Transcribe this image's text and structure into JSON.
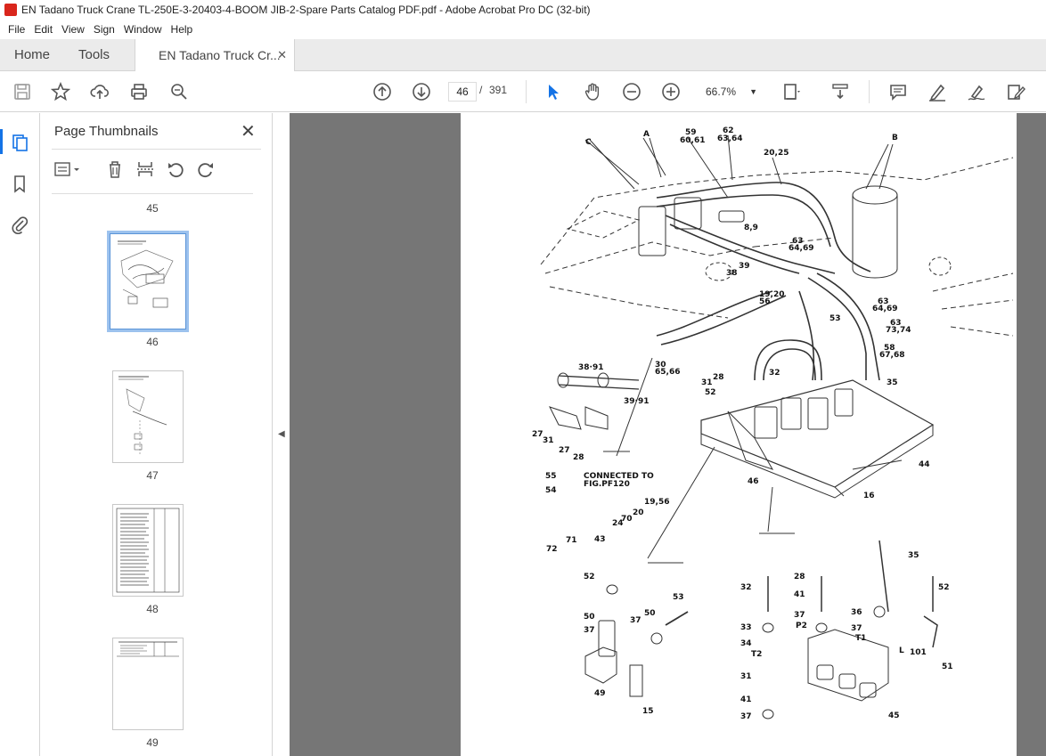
{
  "window": {
    "title": "EN Tadano Truck Crane TL-250E-3-20403-4-BOOM JIB-2-Spare Parts Catalog PDF.pdf - Adobe Acrobat Pro DC (32-bit)"
  },
  "menu": [
    "File",
    "Edit",
    "View",
    "Sign",
    "Window",
    "Help"
  ],
  "tabs": {
    "home": "Home",
    "tools": "Tools",
    "doc": "EN Tadano Truck Cr...",
    "close": "✕"
  },
  "toolbar": {
    "page_current": "46",
    "page_sep": "/",
    "page_total": "391",
    "zoom": "66.7%"
  },
  "panel": {
    "title": "Page Thumbnails",
    "close": "✕",
    "thumbnails": [
      "45",
      "46",
      "47",
      "48",
      "49"
    ],
    "selected": "46"
  },
  "diagram": {
    "labels": [
      "C",
      "A",
      "B",
      "59",
      "60,61",
      "62",
      "63,64",
      "20,25",
      "8,9",
      "63",
      "64,69",
      "39",
      "38",
      "19,20",
      "56",
      "53",
      "63",
      "64,69",
      "63",
      "73,74",
      "58",
      "67,68",
      "38·91",
      "30",
      "65,66",
      "31",
      "28",
      "32",
      "52",
      "35",
      "39·91",
      "27",
      "31",
      "27",
      "28",
      "44",
      "46",
      "16",
      "55",
      "54",
      "CONNECTED TO",
      "FIG.PF120",
      "19,56",
      "20",
      "70",
      "24",
      "43",
      "71",
      "72",
      "35",
      "52",
      "53",
      "32",
      "28",
      "41",
      "52",
      "50",
      "37",
      "37",
      "50",
      "37",
      "36",
      "33",
      "34",
      "P2",
      "T2",
      "T1",
      "37",
      "49",
      "L",
      "101",
      "51",
      "31",
      "41",
      "15",
      "37",
      "45"
    ]
  },
  "colors": {
    "accent": "#1473e6",
    "doc_bg": "#767676",
    "selection": "#9cc2ee"
  }
}
